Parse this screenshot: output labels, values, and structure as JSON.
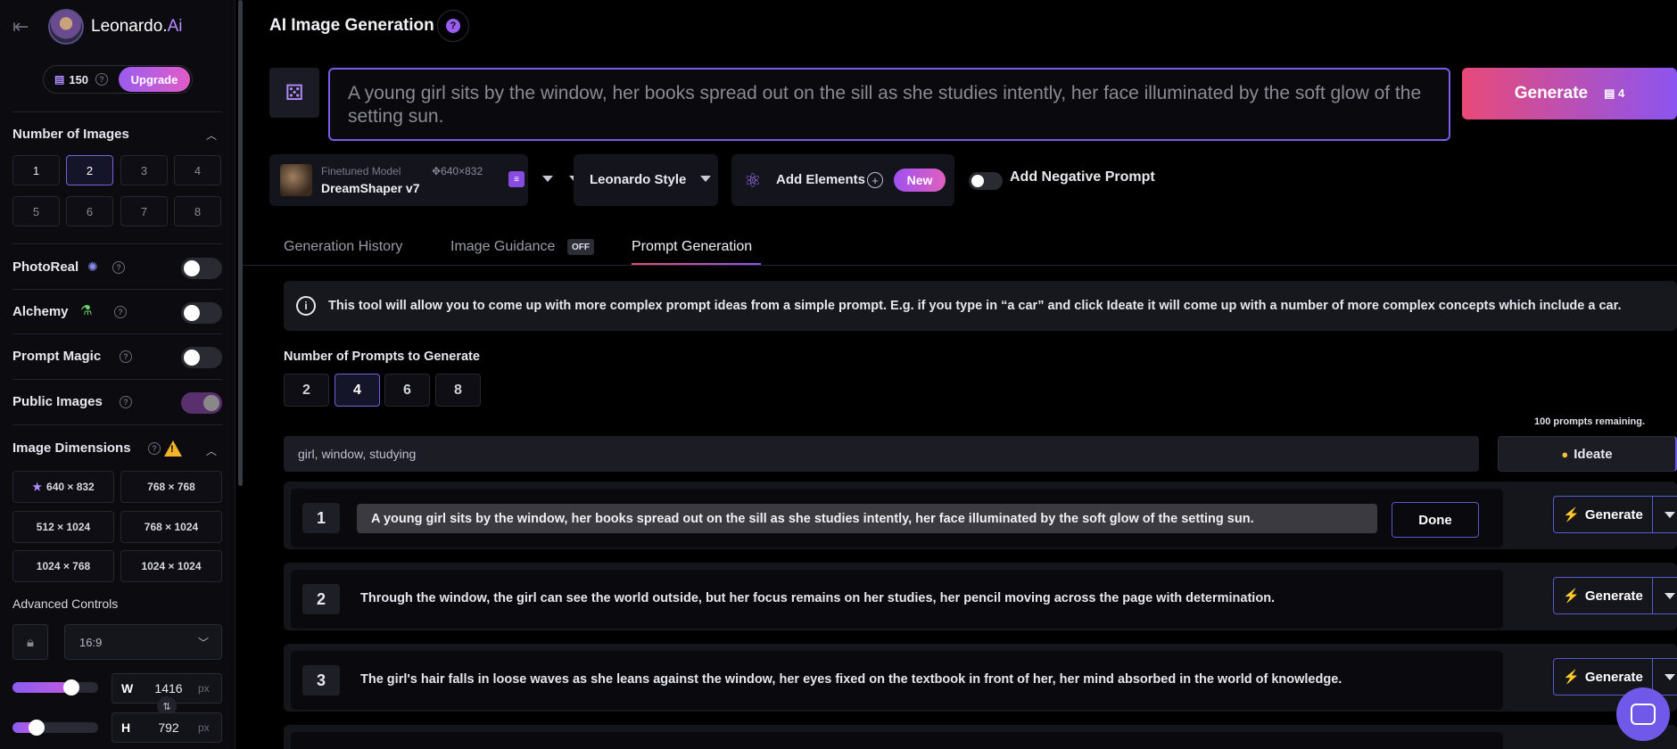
{
  "sidebar": {
    "brand_main": "Leonardo.",
    "brand_ai": "Ai",
    "credits": "150",
    "upgrade_label": "Upgrade",
    "num_images": {
      "title": "Number of Images",
      "options": [
        "1",
        "2",
        "3",
        "4",
        "5",
        "6",
        "7",
        "8"
      ],
      "selected": "2"
    },
    "toggles": {
      "photoreal": "PhotoReal",
      "alchemy": "Alchemy",
      "prompt_magic": "Prompt Magic",
      "public_images": "Public Images"
    },
    "public_images_on": true,
    "image_dimensions": {
      "title": "Image Dimensions",
      "options": [
        "640 × 832",
        "768 × 768",
        "512 × 1024",
        "768 × 1024",
        "1024 × 768",
        "1024 × 1024"
      ]
    },
    "advanced_controls": "Advanced Controls",
    "aspect_ratio": "16:9",
    "width": {
      "label": "W",
      "value": "1416",
      "unit": "px",
      "slider_fraction": 0.73
    },
    "height": {
      "label": "H",
      "value": "792",
      "unit": "px",
      "slider_fraction": 0.23
    }
  },
  "header": {
    "title": "AI Image Generation",
    "help": "?"
  },
  "prompt": {
    "text": "A young girl sits by the window, her books spread out on the sill as she studies intently, her face illuminated by the soft glow of the setting sun.",
    "generate_label": "Generate",
    "generate_cost": "4"
  },
  "controls": {
    "model_sub": "Finetuned Model",
    "model_res": "640×832",
    "model_name": "DreamShaper v7",
    "style": "Leonardo Style",
    "add_elements": "Add Elements",
    "new_badge": "New",
    "negative_prompt": "Add Negative Prompt"
  },
  "tabs": {
    "history": "Generation History",
    "guidance": "Image Guidance",
    "guidance_badge": "OFF",
    "prompt_gen": "Prompt Generation"
  },
  "prompt_gen": {
    "info": "This tool will allow you to come up with more complex prompt ideas from a simple prompt. E.g. if you type in “a car” and click Ideate it will come up with a number of more complex concepts which include a car.",
    "num_label": "Number of Prompts to Generate",
    "num_options": [
      "2",
      "4",
      "6",
      "8"
    ],
    "num_selected": "4",
    "remaining": "100 prompts remaining.",
    "seed": "girl, window, studying",
    "ideate_label": "Ideate",
    "done_label": "Done",
    "row_generate_label": "Generate",
    "prompts": [
      {
        "num": "1",
        "text": "A young girl sits by the window, her books spread out on the sill as she studies intently, her face illuminated by the soft glow of the setting sun."
      },
      {
        "num": "2",
        "text": "Through the window, the girl can see the world outside, but her focus remains on her studies, her pencil moving across the page with determination."
      },
      {
        "num": "3",
        "text": "The girl's hair falls in loose waves as she leans against the window, her eyes fixed on the textbook in front of her, her mind absorbed in the world of knowledge."
      }
    ]
  },
  "colors": {
    "accent": "#7a5ce8",
    "generate_gradient_start": "#e84a78",
    "generate_gradient_end": "#8c55f0"
  }
}
